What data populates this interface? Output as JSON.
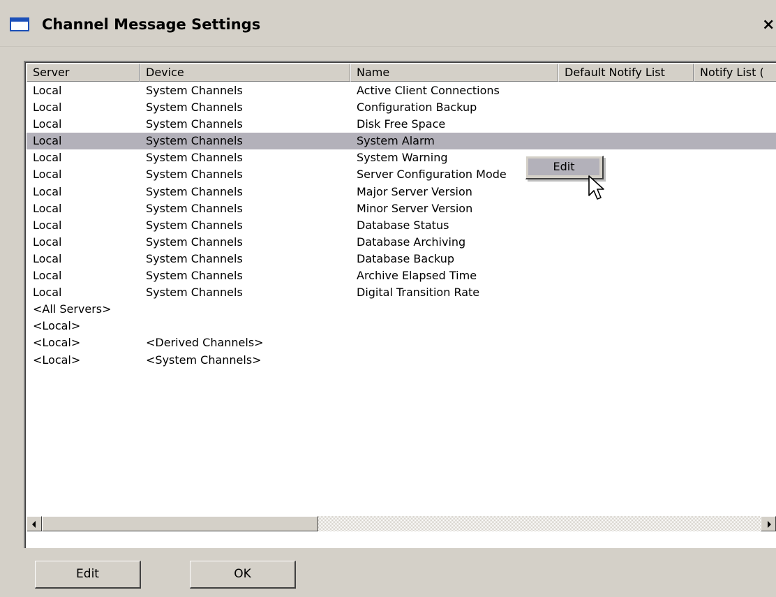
{
  "window": {
    "title": "Channel Message Settings",
    "close_label": "×"
  },
  "table": {
    "columns": [
      "Server",
      "Device",
      "Name",
      "Default Notify List",
      "Notify List ("
    ],
    "rows": [
      [
        "Local",
        "System Channels",
        "Active Client Connections"
      ],
      [
        "Local",
        "System Channels",
        "Configuration Backup"
      ],
      [
        "Local",
        "System Channels",
        "Disk Free Space"
      ],
      [
        "Local",
        "System Channels",
        "System Alarm"
      ],
      [
        "Local",
        "System Channels",
        "System Warning"
      ],
      [
        "Local",
        "System Channels",
        "Server Configuration Mode"
      ],
      [
        "Local",
        "System Channels",
        "Major Server Version"
      ],
      [
        "Local",
        "System Channels",
        "Minor Server Version"
      ],
      [
        "Local",
        "System Channels",
        "Database Status"
      ],
      [
        "Local",
        "System Channels",
        "Database Archiving"
      ],
      [
        "Local",
        "System Channels",
        "Database Backup"
      ],
      [
        "Local",
        "System Channels",
        "Archive Elapsed Time"
      ],
      [
        "Local",
        "System Channels",
        "Digital Transition Rate"
      ],
      [
        "<All Servers>",
        "",
        ""
      ],
      [
        "<Local>",
        "",
        ""
      ],
      [
        "<Local>",
        "<Derived Channels>",
        ""
      ],
      [
        "<Local>",
        "<System Channels>",
        ""
      ]
    ],
    "selected_index": 3
  },
  "context_menu": {
    "items": [
      "Edit"
    ]
  },
  "buttons": {
    "edit_label": "Edit",
    "ok_label": "OK"
  },
  "icons": {
    "scroll_left": "arrow-left-icon",
    "scroll_right": "arrow-right-icon",
    "cursor": "mouse-pointer-icon",
    "window": "window-icon"
  }
}
